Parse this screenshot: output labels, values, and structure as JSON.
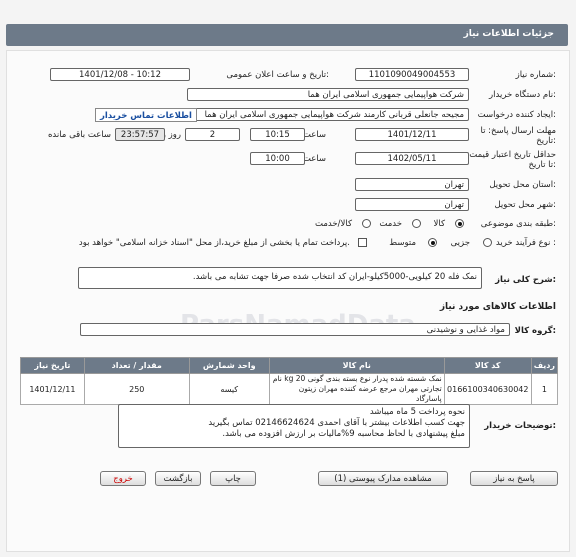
{
  "header": {
    "title": "جزئیات اطلاعات نیاز"
  },
  "form": {
    "need_number_label": "شماره نیاز:",
    "need_number": "1101090049004553",
    "announce_label": "تاریخ و ساعت اعلان عمومی:",
    "announce_value": "1401/12/08 - 10:12",
    "buyer_org_label": "نام دستگاه خریدار:",
    "buyer_org": "شرکت هواپیمایی جمهوری اسلامی ایران هما",
    "creator_label": "ایجاد کننده درخواست:",
    "creator": "مجیحه جانعلی قربانی کارمند شرکت هواپیمایی جمهوری اسلامی ایران هما",
    "contact_link": "اطلاعات تماس خریدار",
    "deadline_label": "مهلت ارسال پاسخ: تا تاریخ:",
    "deadline_date": "1401/12/11",
    "time_label": "ساعت",
    "deadline_time": "10:15",
    "days": "2",
    "days_label": "روز و",
    "remaining_time": "23:57:57",
    "remaining_label": "ساعت باقی مانده",
    "price_validity_label": "حداقل تاریخ اعتبار قیمت: تا تاریخ:",
    "price_validity_date": "1402/05/11",
    "price_validity_time": "10:00",
    "province_label": "استان محل تحویل:",
    "province": "تهران",
    "city_label": "شهر محل تحویل:",
    "city": "تهران",
    "category_label": "طبقه بندی موضوعی:",
    "category_options": [
      "کالا",
      "خدمت",
      "کالا/خدمت"
    ],
    "category_selected": "کالا",
    "process_label": "نوع فرآیند خرید :",
    "process_options": [
      "جزیی",
      "متوسط"
    ],
    "process_selected": "متوسط",
    "payment_note": "پرداخت تمام یا بخشی از مبلغ خرید،از محل \"اسناد خزانه اسلامی\" خواهد بود.",
    "summary_label": "شرح کلی نیاز:",
    "summary": "نمک فله 20 کیلویی-5000کیلو-ایران کد انتخاب شده صرفا جهت تشابه می باشد.",
    "goods_info_title": "اطلاعات کالاهای مورد نیاز",
    "goods_group_label": "گروه کالا:",
    "goods_group": "مواد غذایی و نوشیدنی",
    "notes_label": "توضیحات خریدار:",
    "notes_lines": [
      "نحوه پرداخت 5 ماه میباشد",
      "جهت کسب اطلاعات بیشتر با آقای احمدی  02146624624  تماس بگیرید",
      "مبلغ پیشنهادی با لحاظ محاسبه 9%مالیات بر ارزش افزوده می باشد."
    ]
  },
  "table": {
    "headers": [
      "ردیف",
      "کد کالا",
      "نام کالا",
      "واحد شمارش",
      "مقدار / تعداد",
      "تاریخ نیاز"
    ],
    "rows": [
      {
        "row": "1",
        "code": "0166100340630042",
        "name": "نمک شسته شده پدرار نوع بسته بندی گونی 20 kg نام تجارتی مهران مرجع عرضه کننده مهران زیتون پاسارگاد",
        "unit": "کیسه",
        "qty": "250",
        "date": "1401/12/11"
      }
    ]
  },
  "buttons": {
    "reply": "پاسخ به نیاز",
    "attachments": "مشاهده مدارک پیوستی (1)",
    "print": "چاپ",
    "back": "بازگشت",
    "exit": "خروج"
  },
  "watermark": {
    "brand": "ParsNamadData"
  },
  "colors": {
    "header": "#6d7a89",
    "link": "#1a4fa0",
    "exit": "#cc0000"
  }
}
